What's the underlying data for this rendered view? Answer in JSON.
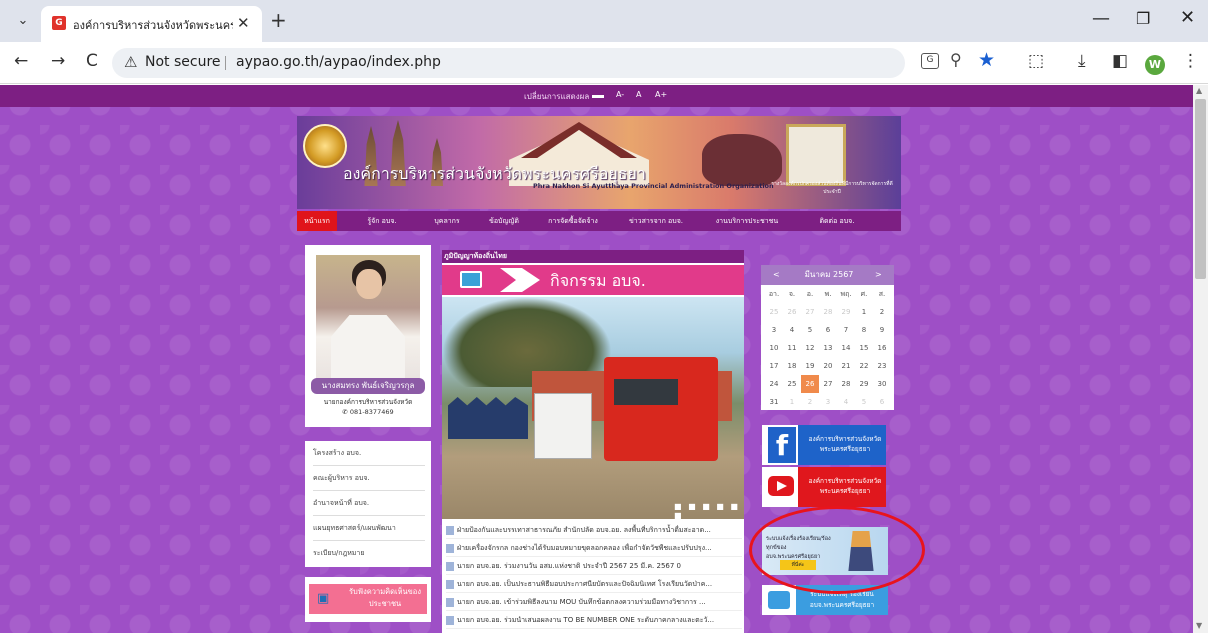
{
  "browser": {
    "tab_title": "องค์การบริหารส่วนจังหวัดพระนครศรีอ",
    "favicon_letter": "G",
    "close_glyph": "✕",
    "new_tab_glyph": "+",
    "not_secure": "Not secure",
    "url": "aypao.go.th/aypao/index.php",
    "profile_letter": "W",
    "translate_glyph": "G",
    "controls": {
      "back": "←",
      "forward": "→",
      "reload": "C",
      "minimize": "—",
      "maximize": "❐",
      "close": "✕",
      "tab_search": "⌄",
      "extensions": "⬚",
      "download": "⤓",
      "sidebar": "◧",
      "menu": "⋮",
      "warning": "⚠",
      "zoom": "⚲",
      "star": "★"
    }
  },
  "site": {
    "accessibility": {
      "label": "เปลี่ยนการแสดงผล",
      "font_small": "A-",
      "font_normal": "A",
      "font_large": "A+"
    },
    "banner": {
      "title_th": "องค์การบริหารส่วนจังหวัดพระนครศรีอยุธยา",
      "title_en": "Phra Nakhon Si Ayutthaya Provincial Administration Organization",
      "certificate_caption": "รางวัลองค์กรปกครองส่วนท้องถิ่นที่มีการบริหารจัดการที่ดี ประจำปี"
    },
    "nav": [
      "หน้าแรก",
      "รู้จัก อบจ.",
      "บุคลากร",
      "ข้อบัญญัติ",
      "การจัดซื้อจัดจ้าง",
      "ข่าวสารจาก อบจ.",
      "งานบริการประชาชน",
      "ติดต่อ อบจ."
    ],
    "mayor": {
      "name": "นางสมทรง พันธ์เจริญวรกุล",
      "title": "นายกองค์การบริหารส่วนจังหวัด",
      "phone": "081-8377469"
    },
    "left_menu": [
      "โครงสร้าง อบจ.",
      "คณะผู้บริหาร อบจ.",
      "อำนาจหน้าที่ อบจ.",
      "แผนยุทธศาสตร์/แผนพัฒนา",
      "ระเบียบ/กฎหมาย"
    ],
    "opinion_button": "รับฟังความคิดเห็นของประชาชน",
    "center": {
      "header": "ภูมิปัญญาท้องถิ่นไทย",
      "activity_title": "กิจกรรม อบจ.",
      "slide_dots": "■ ■ ■ ■ ■ ■",
      "news": [
        "ฝ่ายป้องกันและบรรเทาสาธารณภัย สำนักปลัด อบจ.อย. ลงพื้นที่บริการน้ำดื่มสะอาด...",
        "ฝ่ายเครื่องจักรกล กองช่างได้รับมอบหมายขุดลอกคลอง เพื่อกำจัดวัชพืชและปรับปรุง...",
        "นายก อบจ.อย. ร่วมงานวัน อสม.แห่งชาติ ประจำปี 2567  25 มี.ค. 2567  0",
        "นายก อบจ.อย. เป็นประธานพิธีมอบประกาศนียบัตรและปัจฉิมนิเทศ โรงเรียนวัดป่าค...",
        "นายก อบจ.อย. เข้าร่วมพิธีลงนาม MOU บันทึกข้อตกลงความร่วมมือทางวิชาการ ...",
        "นายก อบจ.อย. ร่วมนำเสนอผลงาน TO BE NUMBER ONE ระดับภาคกลางและตะวั..."
      ]
    },
    "calendar": {
      "prev": "<",
      "next": ">",
      "month": "มีนาคม 2567",
      "weekdays": [
        "อา.",
        "จ.",
        "อ.",
        "พ.",
        "พฤ.",
        "ศ.",
        "ส."
      ],
      "weeks": [
        [
          "25",
          "26",
          "27",
          "28",
          "29",
          "1",
          "2"
        ],
        [
          "3",
          "4",
          "5",
          "6",
          "7",
          "8",
          "9"
        ],
        [
          "10",
          "11",
          "12",
          "13",
          "14",
          "15",
          "16"
        ],
        [
          "17",
          "18",
          "19",
          "20",
          "21",
          "22",
          "23"
        ],
        [
          "24",
          "25",
          "26",
          "27",
          "28",
          "29",
          "30"
        ],
        [
          "31",
          "1",
          "2",
          "3",
          "4",
          "5",
          "6"
        ]
      ],
      "today": "26"
    },
    "facebook_label": "องค์การบริหารส่วนจังหวัดพระนครศรีอยุธยา",
    "youtube_label": "องค์การบริหารส่วนจังหวัดพระนครศรีอยุธยา",
    "complaint": {
      "text": "ระบบแจ้งเรื่องร้องเรียน/ร้องทุกข์ของ อบจ.พระนครศรีอยุธยา",
      "button": "ที่นี่ค่ะ"
    },
    "mail_label": "ระบบแจ้งเหตุ ร้องเรียน อบจ.พระนครศรีอยุธยา"
  },
  "colors": {
    "page_bg": "#9e4fc6",
    "nav_bg": "#7d1f83",
    "nav_active": "#e0141b",
    "highlight_circle": "#e8141c"
  }
}
